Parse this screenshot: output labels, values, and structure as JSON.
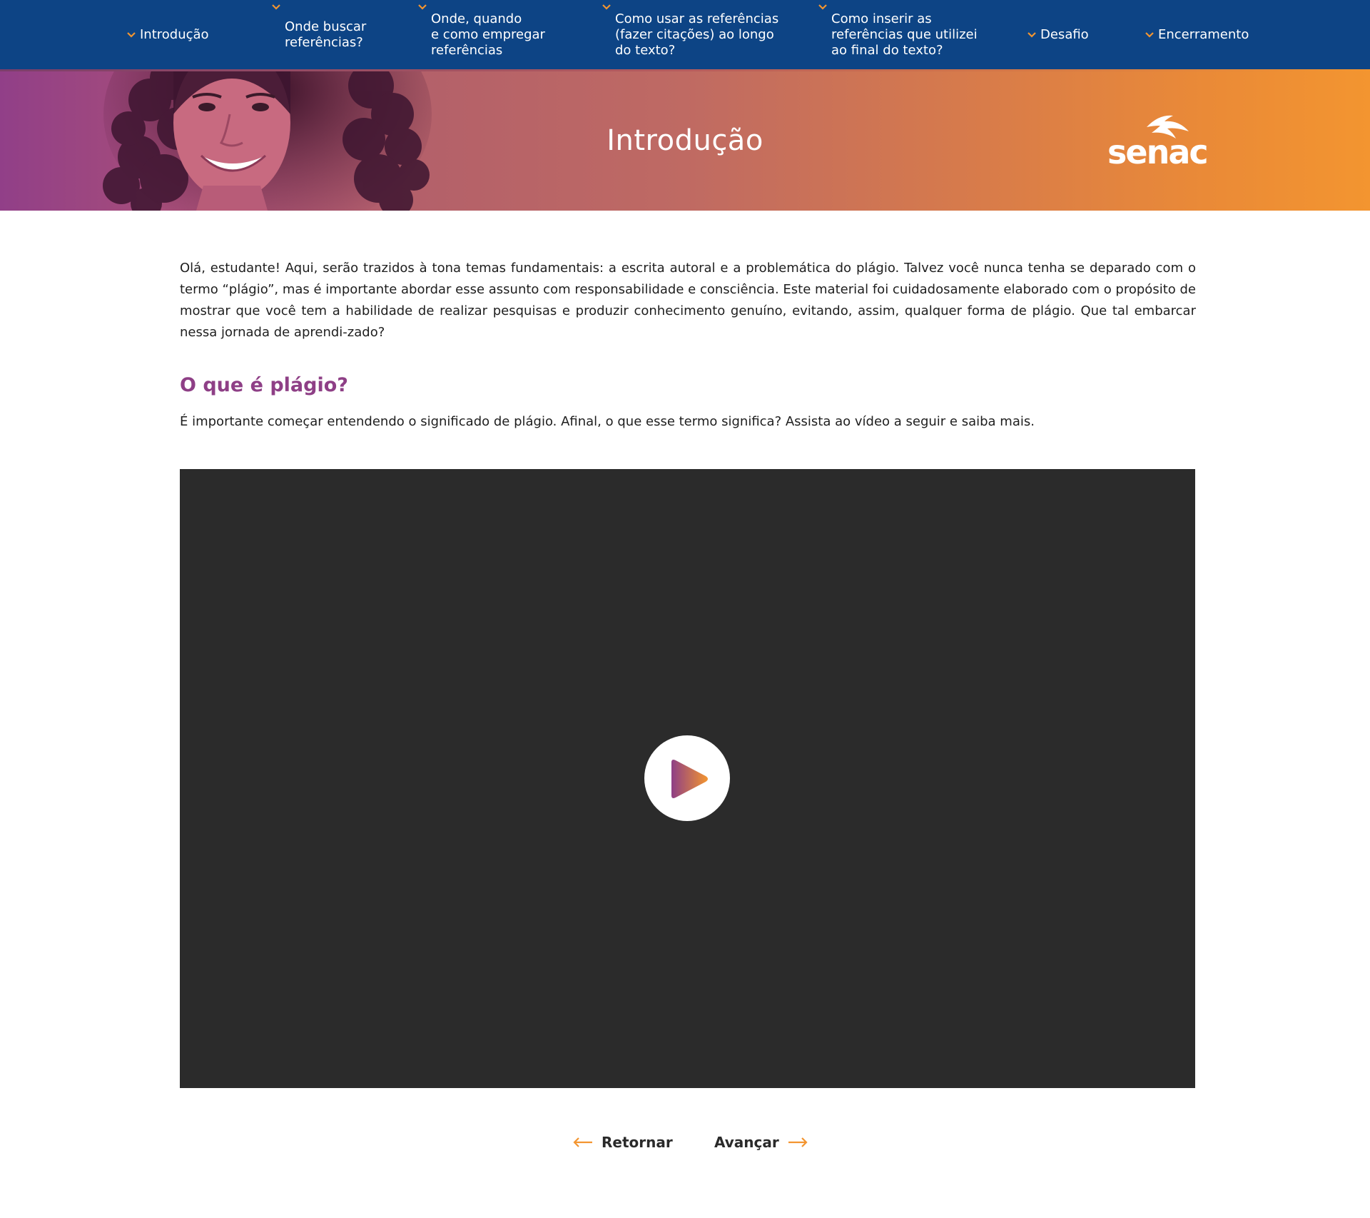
{
  "nav": {
    "items": [
      {
        "label": "Introdução"
      },
      {
        "label": "Onde buscar\nreferências?"
      },
      {
        "label": "Onde, quando\ne como empregar\nreferências"
      },
      {
        "label": "Como usar as referências\n(fazer citações) ao longo\ndo texto?"
      },
      {
        "label": "Como inserir as\nreferências que utilizei\nao final do texto?"
      },
      {
        "label": "Desafio"
      },
      {
        "label": "Encerramento"
      }
    ]
  },
  "banner": {
    "title": "Introdução",
    "logo_text": "senac"
  },
  "content": {
    "intro": "Olá, estudante! Aqui, serão trazidos à tona temas fundamentais: a escrita autoral e a problemática do plágio. Talvez você nunca tenha se deparado com o termo “plágio”, mas é importante abordar esse assunto com responsabilidade e consciência. Este material foi cuidadosamente elaborado com o propósito de mostrar que você tem a habilidade de realizar pesquisas e produzir conhecimento genuíno, evitando, assim, qualquer forma de plágio. Que tal embarcar nessa jornada de aprendi-zado?",
    "section_title": "O que é plágio?",
    "section_text": "É importante começar entendendo o significado de plágio. Afinal, o que esse termo significa? Assista ao vídeo a seguir e saiba mais."
  },
  "footer": {
    "back_label": "Retornar",
    "next_label": "Avançar"
  },
  "colors": {
    "nav_bg": "#0d4485",
    "accent_orange": "#f39530",
    "accent_purple": "#8e3f86",
    "video_bg": "#2b2b2b"
  }
}
